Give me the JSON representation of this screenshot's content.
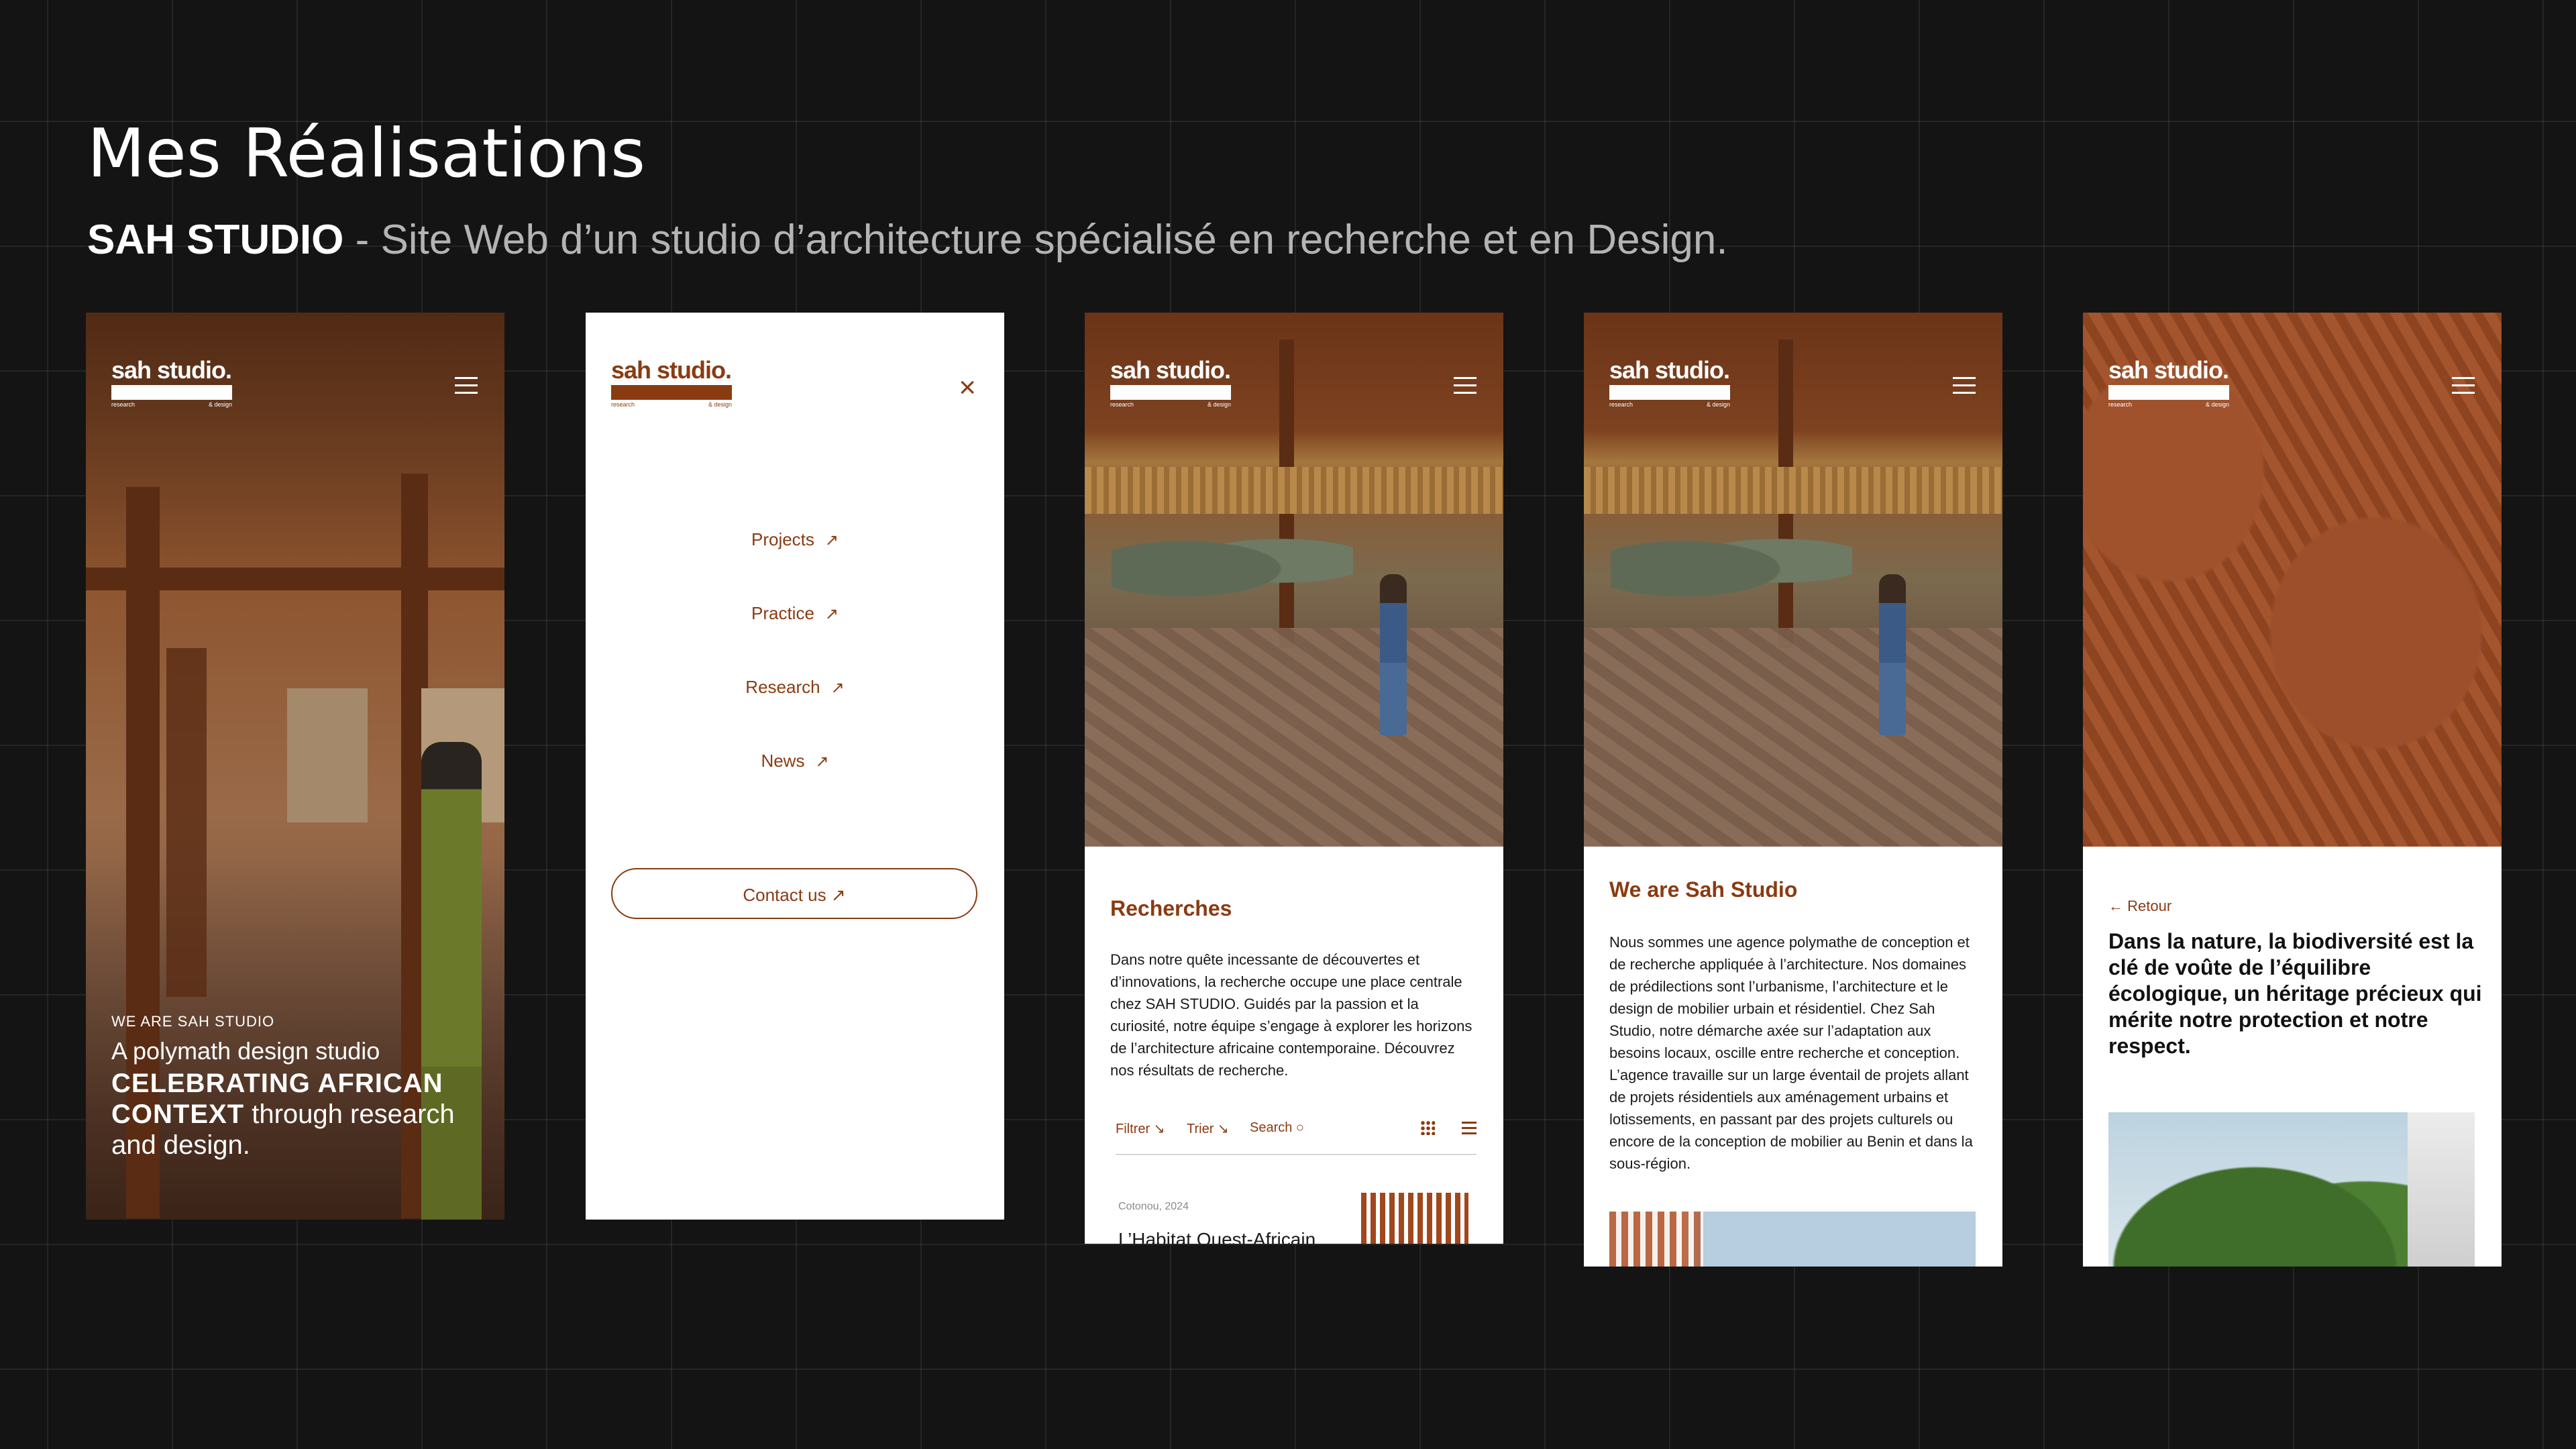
{
  "page": {
    "title": "Mes Réalisations",
    "subtitle_brand": "SAH STUDIO",
    "subtitle_text": " - Site Web d’un studio d’architecture spécialisé en recherche et en Design."
  },
  "logo": {
    "word": "sah studio.",
    "sub_left": "research",
    "sub_right": "& design"
  },
  "screen1": {
    "eyebrow": "WE ARE SAH STUDIO",
    "lead": "A polymath design studio",
    "headline_bold": "CELEBRATING AFRICAN CONTEXT",
    "headline_rest": " through research and design."
  },
  "screen2": {
    "menu": [
      {
        "label": "Projects",
        "arrow": "↗"
      },
      {
        "label": "Practice",
        "arrow": "↗"
      },
      {
        "label": "Research",
        "arrow": "↗"
      },
      {
        "label": "News",
        "arrow": "↗"
      }
    ],
    "contact": "Contact us ↗",
    "close": "×"
  },
  "screen3": {
    "title": "Recherches",
    "body": "Dans notre quête incessante de découvertes et d’innovations, la recherche occupe une place centrale chez SAH STUDIO. Guidés par la passion et la curiosité, notre équipe s’engage à explorer les horizons de l’architecture africaine contemporaine. Découvrez nos résultats de recherche.",
    "filter": "Filtrer ↘",
    "sort": "Trier ↘",
    "search": "Search ○",
    "card_date": "Cotonou, 2024",
    "card_title": "L’Habitat Ouest-Africain"
  },
  "screen4": {
    "title": "We are Sah Studio",
    "body": "Nous sommes une agence polymathe de conception et de recherche appliquée à l’architecture. Nos domaines de prédilections sont l’urbanisme, l’architecture et le design de mobilier urbain et résidentiel. Chez Sah Studio, notre démarche axée sur l’adaptation aux besoins locaux, oscille entre recherche et conception. L’agence travaille sur un large éventail de projets allant de projets résidentiels aux aménagement urbains et lotissements, en passant par des projets culturels ou encore de la conception de mobilier au Benin et dans la sous-région."
  },
  "screen5": {
    "back": "← Retour",
    "quote": "Dans la nature, la biodiversité est la clé de voûte de l’équilibre écologique, un héritage précieux qui mérite notre protection et notre respect."
  },
  "colors": {
    "brand": "#8a3b12",
    "background": "#141414"
  },
  "icons": [
    "menu-icon",
    "close-icon",
    "arrow-up-right-icon",
    "grid-view-icon",
    "list-view-icon",
    "search-icon",
    "arrow-left-icon"
  ]
}
